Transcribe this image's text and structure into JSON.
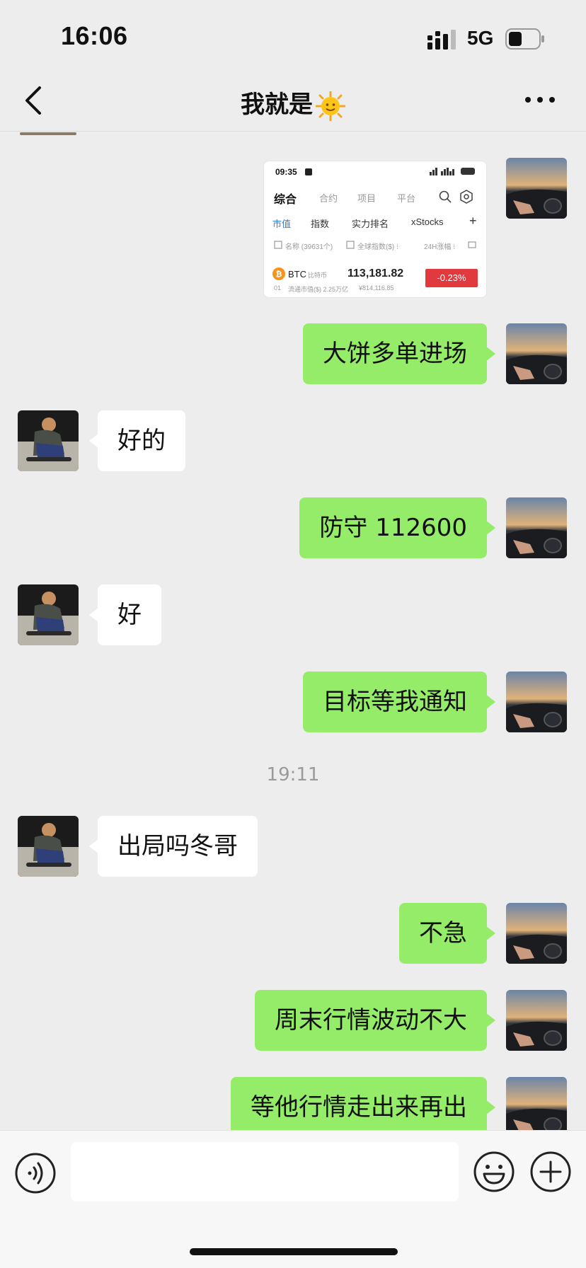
{
  "status_bar": {
    "time": "16:06",
    "network": "5G"
  },
  "nav": {
    "title": "我就是"
  },
  "image_message": {
    "time": "09:35",
    "tabs": [
      "综合",
      "合约",
      "项目",
      "平台"
    ],
    "subtabs": [
      "市值",
      "指数",
      "实力排名",
      "xStocks"
    ],
    "filter_name": "名称 (39631个)",
    "filter_index": "全球指数($) ⁝",
    "filter_change": "24H涨幅 ⁝",
    "coin_rank": "01",
    "coin_symbol": "BTC",
    "coin_name": "比特币",
    "coin_cap": "流通市值($) 2.25万亿",
    "coin_price": "113,181.82",
    "coin_price_cny": "¥814,116.85",
    "coin_change": "-0.23%"
  },
  "messages": [
    {
      "from": "me",
      "text": "大饼多单进场"
    },
    {
      "from": "them",
      "text": "好的"
    },
    {
      "from": "me",
      "text": "防守 112600"
    },
    {
      "from": "them",
      "text": "好"
    },
    {
      "from": "me",
      "text": "目标等我通知"
    },
    {
      "from": "them",
      "text": "出局吗冬哥"
    },
    {
      "from": "me",
      "text": "不急"
    },
    {
      "from": "me",
      "text": "周末行情波动不大"
    },
    {
      "from": "me",
      "text": "等他行情走出来再出"
    }
  ],
  "timestamp": "19:11",
  "colors": {
    "my_bubble": "#95ec69",
    "their_bubble": "#ffffff",
    "background": "#ededed",
    "change_down": "#e0393e"
  }
}
